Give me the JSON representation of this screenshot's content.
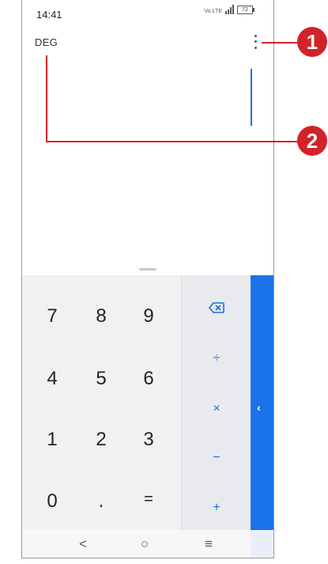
{
  "status_bar": {
    "time": "14:41",
    "network_label": "Vo LTE",
    "battery": "72"
  },
  "calculator": {
    "angle_mode": "DEG",
    "digit_keys": [
      [
        "7",
        "8",
        "9"
      ],
      [
        "4",
        "5",
        "6"
      ],
      [
        "1",
        "2",
        "3"
      ],
      [
        "0",
        ".",
        "="
      ]
    ],
    "operators": [
      "÷",
      "×",
      "−",
      "+"
    ]
  },
  "navigation": {
    "back": "<",
    "home": "○",
    "recents": "≡"
  },
  "callouts": [
    "1",
    "2"
  ],
  "icons": [
    "more-options-icon",
    "backspace-icon",
    "chevron-left-icon"
  ],
  "colors": {
    "accent": "#1a73e8",
    "callout": "#d2232a"
  }
}
